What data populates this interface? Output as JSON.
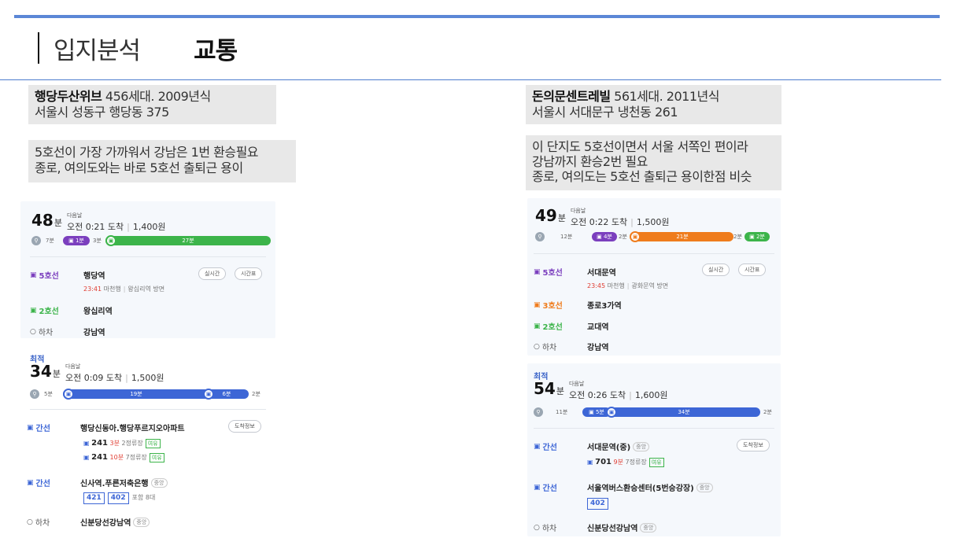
{
  "header": {
    "section": "입지분석",
    "topic": "교통"
  },
  "left": {
    "apt_name": "행당두산위브",
    "apt_info": " 456세대.  2009년식",
    "address": "서울시 성동구 행당동 375",
    "note_line1": "5호선이 가장 가까워서 강남은 1번 환승필요",
    "note_line2": "종로, 여의도와는 바로 5호선 출퇴근 용이",
    "route1": {
      "minutes": "48",
      "unit": "분",
      "next_day": "다음날",
      "arrival": "오전 0:21 도착",
      "fare": "1,400원",
      "walk1": "7분",
      "seg1": "1분",
      "gap1": "3분",
      "seg2": "27분",
      "leg1_line": "5호선",
      "leg1_station": "행당역",
      "leg1_time": "23:41",
      "leg1_dir": "마천행",
      "leg1_toward": "왕십리역 방면",
      "btn_realtime": "실시간",
      "btn_timetable": "시간표",
      "leg2_line": "2호선",
      "leg2_station": "왕십리역",
      "leg3_line": "하차",
      "leg3_station": "강남역"
    },
    "route2": {
      "best": "최적",
      "minutes": "34",
      "unit": "분",
      "next_day": "다음날",
      "arrival": "오전 0:09 도착",
      "fare": "1,500원",
      "walk1": "5분",
      "seg1": "19분",
      "seg2": "6분",
      "tail": "2분",
      "leg1_line": "간선",
      "leg1_station": "행당신동아.행당푸르지오아파트",
      "btn_arrival": "도착정보",
      "bus1": "241",
      "bus1_time": "3분",
      "bus1_stops": "2정류장",
      "bus1_seat": "여유",
      "bus2": "241",
      "bus2_time": "10분",
      "bus2_stops": "7정류장",
      "bus2_seat": "여유",
      "leg2_line": "간선",
      "leg2_station": "신사역.푸른저축은행",
      "leg2_tag": "중앙",
      "leg2_bus_a": "421",
      "leg2_bus_b": "402",
      "leg2_more": "포함 8대",
      "leg3_line": "하차",
      "leg3_station": "신분당선강남역",
      "leg3_tag": "중앙"
    }
  },
  "right": {
    "apt_name": "돈의문센트레빌",
    "apt_info": " 561세대.  2011년식",
    "address": "서울시 서대문구 냉천동 261",
    "note_line1": "이 단지도 5호선이면서 서울 서쪽인 편이라",
    "note_line2": "강남까지 환승2번 필요",
    "note_line3": "종로, 여의도는 5호선 출퇴근 용이한점 비슷",
    "route1": {
      "minutes": "49",
      "unit": "분",
      "next_day": "다음날",
      "arrival": "오전 0:22 도착",
      "fare": "1,500원",
      "walk1": "12분",
      "seg1": "4분",
      "gap1": "2분",
      "seg2": "21분",
      "gap2": "2분",
      "seg3": "2분",
      "leg1_line": "5호선",
      "leg1_station": "서대문역",
      "leg1_time": "23:45",
      "leg1_dir": "마천행",
      "leg1_toward": "광화문역 방면",
      "btn_realtime": "실시간",
      "btn_timetable": "시간표",
      "leg2_line": "3호선",
      "leg2_station": "종로3가역",
      "leg3_line": "2호선",
      "leg3_station": "교대역",
      "leg4_line": "하차",
      "leg4_station": "강남역"
    },
    "route2": {
      "best": "최적",
      "minutes": "54",
      "unit": "분",
      "next_day": "다음날",
      "arrival": "오전 0:26 도착",
      "fare": "1,600원",
      "walk1": "11분",
      "seg1": "5분",
      "seg2": "34분",
      "tail": "2분",
      "leg1_line": "간선",
      "leg1_station": "서대문역(중)",
      "leg1_tag": "중앙",
      "btn_arrival": "도착정보",
      "bus1": "701",
      "bus1_time": "9분",
      "bus1_stops": "7정류장",
      "bus1_seat": "여유",
      "leg2_line": "간선",
      "leg2_station": "서울역버스환승센터(5번승강장)",
      "leg2_tag": "중앙",
      "leg2_bus_a": "402",
      "leg3_line": "하차",
      "leg3_station": "신분당선강남역",
      "leg3_tag": "중앙"
    }
  },
  "colors": {
    "line5": "#7b3fbe",
    "line2": "#3cb44a",
    "line3": "#ef7c1c",
    "bus": "#3d66d6",
    "rule": "#5b87d6"
  },
  "icons": {
    "subway": "subway-icon",
    "bus": "bus-icon",
    "walk": "walk-icon",
    "alight": "circle-icon"
  }
}
